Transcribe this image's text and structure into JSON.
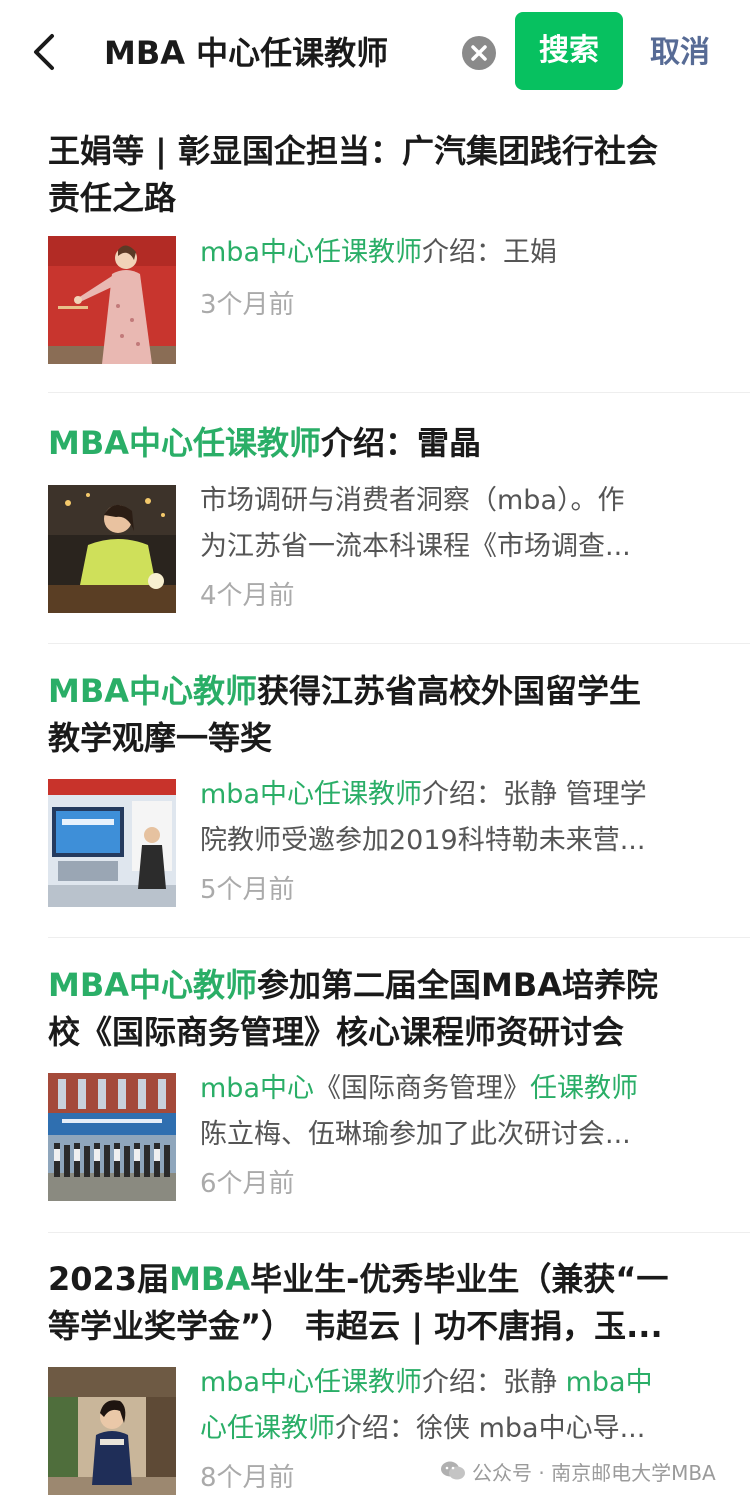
{
  "header": {
    "query": "MBA 中心任课教师",
    "search_label": "搜索",
    "cancel_label": "取消"
  },
  "results": [
    {
      "title": [
        {
          "t": "王娟等 | 彰显国企担当：广汽集团践行社会",
          "hl": false
        }
      ],
      "title2": [
        {
          "t": "责任之路",
          "hl": false
        }
      ],
      "snippet1": [
        {
          "t": "mba中心任课教师",
          "hl": true
        },
        {
          "t": "介绍：王娟",
          "hl": false
        }
      ],
      "snippet2": [],
      "time": "3个月前"
    },
    {
      "title": [
        {
          "t": "MBA中心任课教师",
          "hl": true
        },
        {
          "t": "介绍：雷晶",
          "hl": false
        }
      ],
      "title2": [],
      "snippet1": [
        {
          "t": "市场调研与消费者洞察（mba）。作",
          "hl": false
        }
      ],
      "snippet2": [
        {
          "t": "为江苏省一流本科课程《市场调查...",
          "hl": false
        }
      ],
      "time": "4个月前"
    },
    {
      "title": [
        {
          "t": "MBA中心教师",
          "hl": true
        },
        {
          "t": "获得江苏省高校外国留学生",
          "hl": false
        }
      ],
      "title2": [
        {
          "t": "教学观摩一等奖",
          "hl": false
        }
      ],
      "snippet1": [
        {
          "t": "mba中心任课教师",
          "hl": true
        },
        {
          "t": "介绍：张静 管理学",
          "hl": false
        }
      ],
      "snippet2": [
        {
          "t": "院教师受邀参加2019科特勒未来营...",
          "hl": false
        }
      ],
      "time": "5个月前"
    },
    {
      "title": [
        {
          "t": "MBA中心教师",
          "hl": true
        },
        {
          "t": "参加第二届全国MBA培养院",
          "hl": false
        }
      ],
      "title2": [
        {
          "t": "校《国际商务管理》核心课程师资研讨会",
          "hl": false
        }
      ],
      "snippet1": [
        {
          "t": "mba中心",
          "hl": true
        },
        {
          "t": "《国际商务管理》",
          "hl": false
        },
        {
          "t": "任课教师",
          "hl": true
        }
      ],
      "snippet2": [
        {
          "t": "陈立梅、伍琳瑜参加了此次研讨会...",
          "hl": false
        }
      ],
      "time": "6个月前"
    },
    {
      "title": [
        {
          "t": "2023届",
          "hl": false
        },
        {
          "t": "MBA",
          "hl": true
        },
        {
          "t": "毕业生-优秀毕业生（兼获“一",
          "hl": false
        }
      ],
      "title2": [
        {
          "t": "等学业奖学金”） 韦超云 | 功不唐捐，玉...",
          "hl": false
        }
      ],
      "snippet1": [
        {
          "t": "mba中心任课教师",
          "hl": true
        },
        {
          "t": "介绍：张静 ",
          "hl": false
        },
        {
          "t": "mba中",
          "hl": true
        }
      ],
      "snippet2": [
        {
          "t": "心任课教师",
          "hl": true
        },
        {
          "t": "介绍：徐侠 mba中心导...",
          "hl": false
        }
      ],
      "time": "8个月前"
    }
  ],
  "watermark": {
    "text": "公众号 · 南京邮电大学MBA"
  },
  "colors": {
    "accent": "#07c160",
    "highlight": "#2aae67",
    "cancel": "#576b95"
  }
}
